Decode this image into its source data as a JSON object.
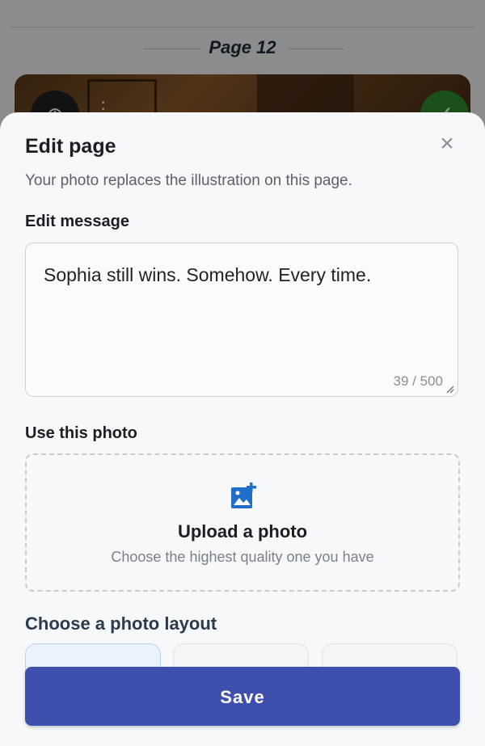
{
  "background": {
    "page_title": "Page 12"
  },
  "sheet": {
    "title": "Edit page",
    "subtitle": "Your photo replaces the illustration on this page.",
    "message_label": "Edit message",
    "message_value": "Sophia still wins. Somehow. Every time.",
    "char_count": "39 / 500",
    "photo_label": "Use this photo",
    "upload_title": "Upload a photo",
    "upload_subtitle": "Choose the highest quality one you have",
    "layout_label": "Choose a photo layout",
    "save_label": "Save"
  },
  "colors": {
    "primary": "#3f4fad",
    "upload_icon": "#1f6fc9"
  },
  "icons": [
    "close-icon",
    "add-photo-icon",
    "zoom-icon",
    "more-vert-icon",
    "check-icon",
    "resize-handle-icon"
  ]
}
